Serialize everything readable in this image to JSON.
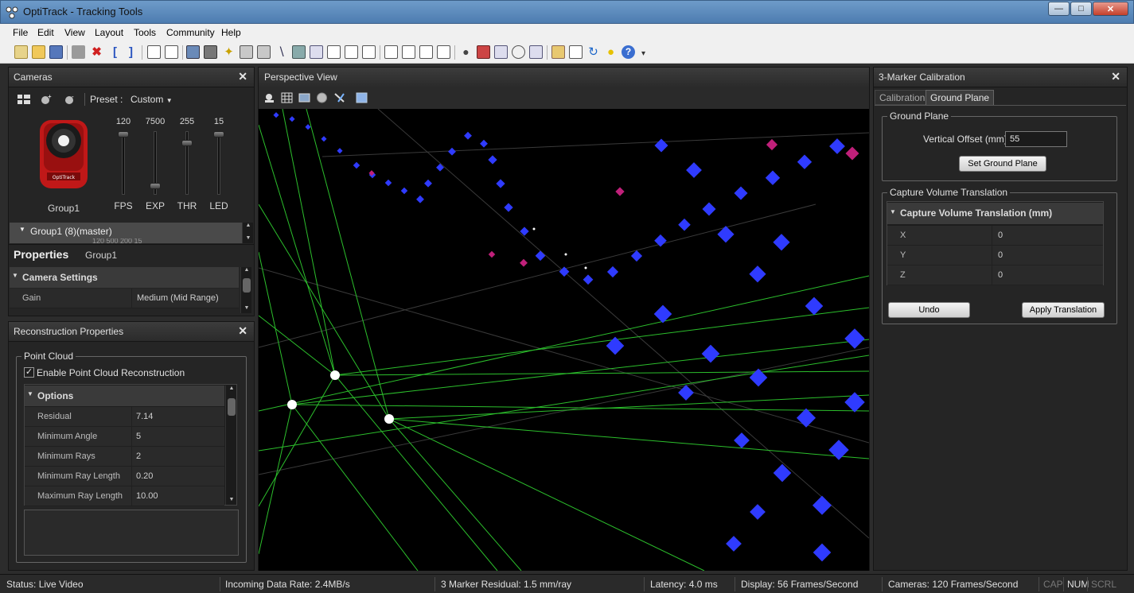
{
  "window": {
    "title": "OptiTrack - Tracking Tools"
  },
  "menu": [
    "File",
    "Edit",
    "View",
    "Layout",
    "Tools",
    "Community",
    "Help"
  ],
  "cameras_panel": {
    "title": "Cameras",
    "preset_label": "Preset :",
    "preset_value": "Custom",
    "camera_name": "Group1",
    "sliders": [
      {
        "label": "FPS",
        "value": "120",
        "level": 1.0
      },
      {
        "label": "EXP",
        "value": "7500",
        "level": 0.1
      },
      {
        "label": "THR",
        "value": "255",
        "level": 0.85
      },
      {
        "label": "LED",
        "value": "15",
        "level": 1.0
      }
    ],
    "group_row": "Group1 (8)(master)",
    "group_row_sub": "120     500     200     15"
  },
  "properties": {
    "title": "Properties",
    "subtitle": "Group1",
    "section": "Camera Settings",
    "rows": [
      {
        "key": "Gain",
        "value": "Medium (Mid Range)"
      }
    ]
  },
  "reconstruction": {
    "title": "Reconstruction Properties",
    "group_title": "Point Cloud",
    "checkbox_label": "Enable Point Cloud Reconstruction",
    "checkbox_checked": true,
    "section": "Options",
    "rows": [
      {
        "key": "Residual",
        "value": "7.14"
      },
      {
        "key": "Minimum Angle",
        "value": "5"
      },
      {
        "key": "Minimum Rays",
        "value": "2"
      },
      {
        "key": "Minimum Ray Length",
        "value": "0.20"
      },
      {
        "key": "Maximum Ray Length",
        "value": "10.00"
      }
    ]
  },
  "viewport": {
    "title": "Perspective View"
  },
  "calibration": {
    "title": "3-Marker Calibration",
    "tabs": [
      "Calibration",
      "Ground Plane"
    ],
    "active_tab": "Ground Plane",
    "ground_plane_title": "Ground Plane",
    "vertical_offset_label": "Vertical Offset (mm)",
    "vertical_offset_value": "55",
    "set_ground_plane": "Set Ground Plane",
    "cvt_title": "Capture Volume Translation",
    "cvt_section": "Capture Volume Translation (mm)",
    "axes": [
      {
        "key": "X",
        "value": "0"
      },
      {
        "key": "Y",
        "value": "0"
      },
      {
        "key": "Z",
        "value": "0"
      }
    ],
    "undo": "Undo",
    "apply": "Apply Translation"
  },
  "status": {
    "status": "Status: Live Video",
    "data_rate": "Incoming Data Rate: 2.4MB/s",
    "residual": "3 Marker Residual: 1.5 mm/ray",
    "latency": "Latency: 4.0 ms",
    "display": "Display: 56 Frames/Second",
    "cameras": "Cameras: 120 Frames/Second",
    "cap": "CAP",
    "num": "NUM",
    "scrl": "SCRL"
  },
  "colors": {
    "accent_blue": "#2f3bff",
    "ray_green": "#2fbf2f",
    "magenta": "#c0207a"
  }
}
